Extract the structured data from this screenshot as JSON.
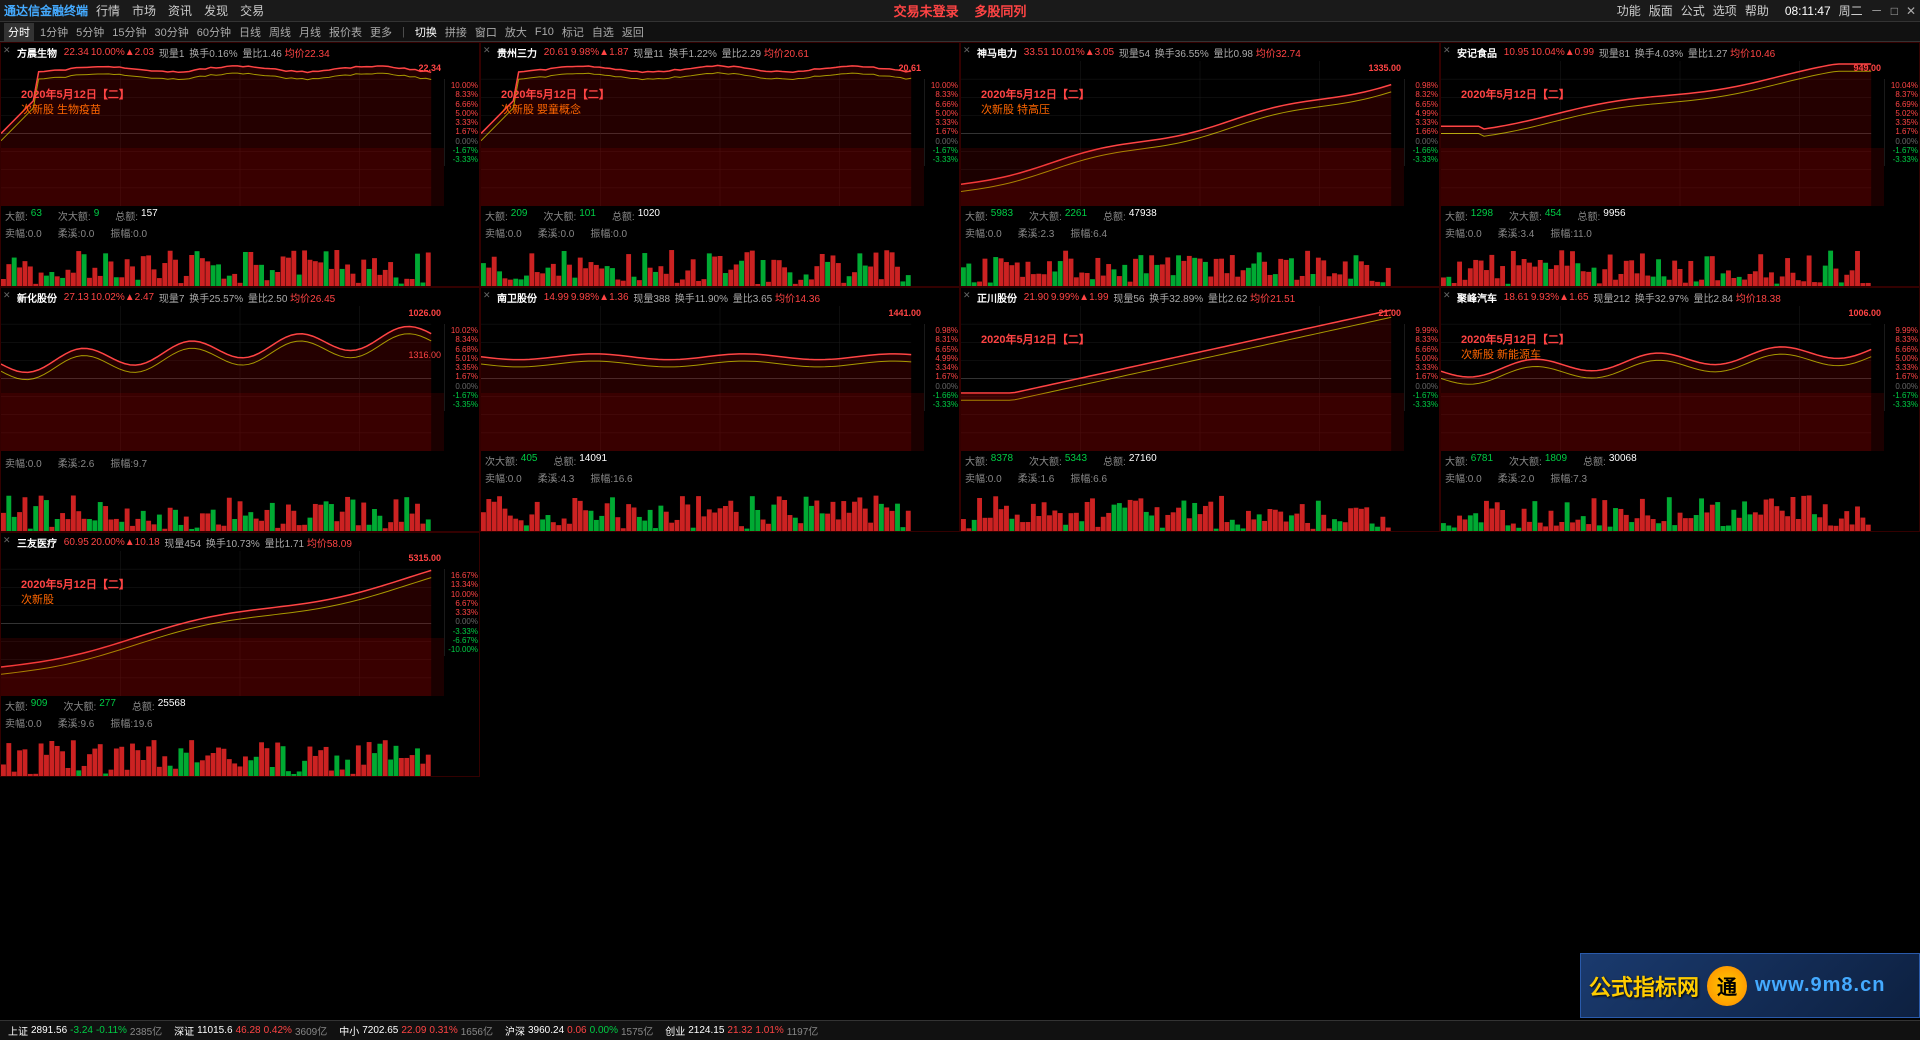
{
  "app": {
    "title": "通达信金融终端",
    "login_status": "交易未登录",
    "multi_stock": "多股同列",
    "time": "08:11:47",
    "weekday": "周二",
    "menu": [
      "行情",
      "市场",
      "资讯",
      "发现",
      "交易"
    ],
    "right_menu": [
      "功能",
      "版面",
      "公式",
      "选项",
      "帮助"
    ],
    "toolbar_items": [
      "切换",
      "拼接",
      "窗口",
      "放大",
      "F10",
      "标记",
      "自选",
      "返回"
    ],
    "time_tabs": [
      "分时",
      "1分钟",
      "5分钟",
      "15分钟",
      "30分钟",
      "60分钟",
      "日线",
      "周线",
      "月线",
      "报价表",
      "更多"
    ]
  },
  "stocks": [
    {
      "id": "fangchen",
      "name": "方晨生物",
      "price": "22.34",
      "change_pct": "10.00%",
      "change_icon": "▲",
      "change_val": "2.03",
      "current": "现量1",
      "turnover": "换手0.16%",
      "ratio": "量比1.46",
      "avg": "均价22.34",
      "date": "2020年5月12日【二】",
      "theme": "次新股 生物疫苗",
      "da_vol": "63",
      "ci_da_vol": "9",
      "total_vol": "157",
      "mai_kuan": "卖幅:0.0",
      "ruo_xi": "柔溪:0.0",
      "bo_fu": "振幅:0.0",
      "price_high": "22.34",
      "pct_levels": [
        "10.00%",
        "8.33%",
        "6.66%",
        "5.00%",
        "3.33%",
        "1.67%",
        "0.00%",
        "-1.67%",
        "-3.33%"
      ]
    },
    {
      "id": "guizhousanli",
      "name": "贵州三力",
      "price": "20.61",
      "change_pct": "9.98%",
      "change_icon": "▲",
      "change_val": "1.87",
      "current": "现量11",
      "turnover": "换手1.22%",
      "ratio": "量比2.29",
      "avg": "均价20.61",
      "date": "2020年5月12日【二】",
      "theme": "次新股 婴童概念",
      "da_vol": "209",
      "ci_da_vol": "101",
      "total_vol": "1020",
      "mai_kuan": "卖幅:0.0",
      "ruo_xi": "柔溪:0.0",
      "bo_fu": "振幅:0.0",
      "price_high": "20.61",
      "pct_levels": [
        "10.00%",
        "8.33%",
        "6.66%",
        "5.00%",
        "3.33%",
        "1.67%",
        "0.00%",
        "-1.67%",
        "-3.33%"
      ]
    },
    {
      "id": "shenmapower",
      "name": "神马电力",
      "price": "33.51",
      "change_pct": "10.01%",
      "change_icon": "▲",
      "change_val": "3.05",
      "current": "现量54",
      "turnover": "换手36.55%",
      "ratio": "量比0.98",
      "avg": "均价32.74",
      "date": "2020年5月12日【二】",
      "theme": "次新股 特高压",
      "da_vol": "5983",
      "ci_da_vol": "2261",
      "total_vol": "47938",
      "mai_kuan": "卖幅:0.0",
      "ruo_xi": "柔溪:2.3",
      "bo_fu": "振幅:6.4",
      "price_high": "1335.00",
      "pct_levels": [
        "0.98%",
        "8.32%",
        "6.65%",
        "4.99%",
        "3.33%",
        "1.66%",
        "0.00%",
        "-1.66%",
        "-3.33%"
      ]
    },
    {
      "id": "anjifood",
      "name": "安记食品",
      "price": "10.95",
      "change_pct": "10.04%",
      "change_icon": "▲",
      "change_val": "0.99",
      "current": "现量81",
      "turnover": "换手4.03%",
      "ratio": "量比1.27",
      "avg": "均价10.46",
      "date": "2020年5月12日【二】",
      "theme": "",
      "da_vol": "1298",
      "ci_da_vol": "454",
      "total_vol": "9956",
      "mai_kuan": "卖幅:0.0",
      "ruo_xi": "柔溪:3.4",
      "bo_fu": "振幅:11.0",
      "price_high": "949.00",
      "pct_levels": [
        "10.04%",
        "8.37%",
        "6.69%",
        "5.02%",
        "3.35%",
        "1.67%",
        "0.00%",
        "-1.67%",
        "-3.33%"
      ]
    },
    {
      "id": "xinhuastock",
      "name": "新化股份",
      "price": "27.13",
      "change_pct": "10.02%",
      "change_icon": "▲",
      "change_val": "2.47",
      "current": "现量7",
      "turnover": "换手25.57%",
      "ratio": "量比2.50",
      "avg": "均价26.45",
      "date": "",
      "theme": "",
      "da_vol": "",
      "ci_da_vol": "",
      "total_vol": "",
      "mai_kuan": "卖幅:0.0",
      "ruo_xi": "柔溪:2.6",
      "bo_fu": "振幅:9.7",
      "price_high": "1026.00",
      "price_low": "1316.00",
      "pct_levels": [
        "10.02%",
        "8.34%",
        "6.68%",
        "5.01%",
        "3.35%",
        "1.67%",
        "0.00%",
        "-1.67%",
        "-3.35%"
      ]
    },
    {
      "id": "nanweistock",
      "name": "南卫股份",
      "price": "14.99",
      "change_pct": "9.98%",
      "change_icon": "▲",
      "change_val": "1.36",
      "current": "现量388",
      "turnover": "换手11.90%",
      "ratio": "量比3.65",
      "avg": "均价14.36",
      "date": "",
      "theme": "",
      "da_vol": "",
      "ci_da_vol": "405",
      "total_vol": "14091",
      "mai_kuan": "卖幅:0.0",
      "ruo_xi": "柔溪:4.3",
      "bo_fu": "振幅:16.6",
      "price_high": "1441.00",
      "pct_levels": [
        "0.98%",
        "8.31%",
        "6.65%",
        "4.99%",
        "3.34%",
        "1.67%",
        "0.00%",
        "-1.66%",
        "-3.33%"
      ]
    },
    {
      "id": "zhengchuanstock",
      "name": "正川股份",
      "price": "21.90",
      "change_pct": "9.99%",
      "change_icon": "▲",
      "change_val": "1.99",
      "current": "现量56",
      "turnover": "换手32.89%",
      "ratio": "量比2.62",
      "avg": "均价21.51",
      "date": "2020年5月12日【二】",
      "theme": "",
      "da_vol": "8378",
      "ci_da_vol": "5343",
      "total_vol": "27160",
      "mai_kuan": "卖幅:0.0",
      "ruo_xi": "柔溪:1.6",
      "bo_fu": "振幅:6.6",
      "price_high": "21.00",
      "pct_levels": [
        "9.99%",
        "8.33%",
        "6.66%",
        "5.00%",
        "3.33%",
        "1.67%",
        "0.00%",
        "-1.67%",
        "-3.33%"
      ]
    },
    {
      "id": "jufengauto",
      "name": "聚峰汽车",
      "price": "18.61",
      "change_pct": "9.93%",
      "change_icon": "▲",
      "change_val": "1.65",
      "current": "现量212",
      "turnover": "换手32.97%",
      "ratio": "量比2.84",
      "avg": "均价18.38",
      "date": "2020年5月12日【二】",
      "theme": "次新股 新能源车",
      "da_vol": "6781",
      "ci_da_vol": "1809",
      "total_vol": "30068",
      "mai_kuan": "卖幅:0.0",
      "ruo_xi": "柔溪:2.0",
      "bo_fu": "振幅:7.3",
      "price_high": "1006.00",
      "pct_levels": [
        "9.99%",
        "8.33%",
        "6.66%",
        "5.00%",
        "3.33%",
        "1.67%",
        "0.00%",
        "-1.67%",
        "-3.33%"
      ]
    },
    {
      "id": "sanyoumedical",
      "name": "三友医疗",
      "price": "60.95",
      "change_pct": "20.00%",
      "change_icon": "▲",
      "change_val": "10.18",
      "current": "现量454",
      "turnover": "换手10.73%",
      "ratio": "量比1.71",
      "avg": "均价58.09",
      "date": "2020年5月12日【二】",
      "theme": "次新股",
      "da_vol": "909",
      "ci_da_vol": "277",
      "total_vol": "25568",
      "mai_kuan": "卖幅:0.0",
      "ruo_xi": "柔溪:9.6",
      "bo_fu": "振幅:19.6",
      "price_high": "5315.00",
      "pct_levels": [
        "16.67%",
        "13.34%",
        "10.00%",
        "6.67%",
        "3.33%",
        "0.00%",
        "-3.33%",
        "-6.67%",
        "-10.00%"
      ]
    }
  ],
  "bottom": {
    "sh_index": "上证",
    "sh_val": "2891.56",
    "sh_change": "-3.24",
    "sh_pct": "-0.11%",
    "sh_vol": "2385亿",
    "sz_index": "深证",
    "sz_val": "11015.6",
    "sz_change": "46.28",
    "sz_pct": "0.42%",
    "sz_vol": "3609亿",
    "mid_index": "中小",
    "mid_val": "7202.65",
    "mid_change": "22.09",
    "mid_pct": "0.31%",
    "mid_vol": "1656亿",
    "hushen_index": "沪深",
    "hushen_val": "3960.24",
    "hushen_change": "0.06",
    "hushen_pct": "0.00%",
    "hushen_vol": "1575亿",
    "cy_index": "创业",
    "cy_val": "2124.15",
    "cy_change": "21.32",
    "cy_pct": "1.01%",
    "cy_vol": "1197亿"
  }
}
